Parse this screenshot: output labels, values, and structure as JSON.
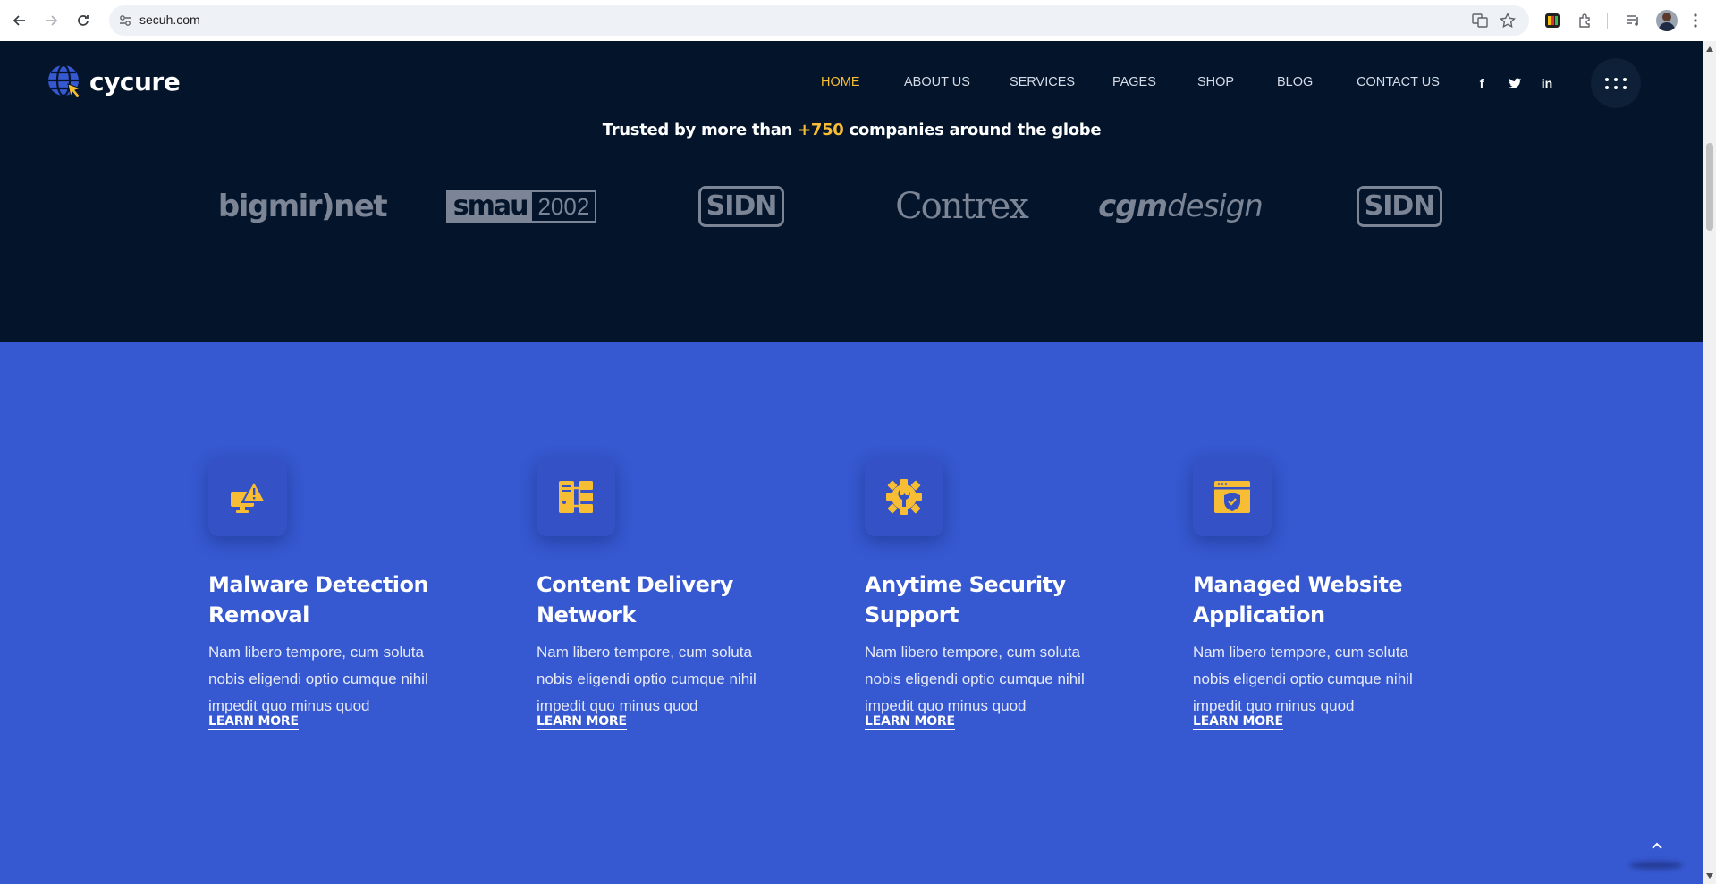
{
  "browser": {
    "url": "secuh.com"
  },
  "header": {
    "logo_text": "cycure",
    "menu": [
      {
        "label": "HOME",
        "active": true
      },
      {
        "label": "ABOUT US",
        "active": false
      },
      {
        "label": "SERVICES",
        "active": false
      },
      {
        "label": "PAGES",
        "active": false
      },
      {
        "label": "SHOP",
        "active": false
      },
      {
        "label": "BLOG",
        "active": false
      },
      {
        "label": "CONTACT US",
        "active": false
      }
    ],
    "social": [
      "facebook-icon",
      "twitter-icon",
      "linkedin-icon"
    ],
    "social_glyphs": {
      "facebook": "f",
      "linkedin": "in"
    }
  },
  "trusted": {
    "prefix": "Trusted by more than",
    "highlight": "+750",
    "suffix": "companies around the globe"
  },
  "partners": {
    "bigmir": "bigmir)net",
    "smau_left": "smau",
    "smau_right": "2002",
    "sidn": "SIDN",
    "contrex": "Contrex",
    "cgm_bold": "cgm",
    "cgm_rest": "design"
  },
  "services": [
    {
      "icon": "malware-warning-icon",
      "title": "Malware Detection Removal",
      "text": "Nam libero tempore, cum soluta nobis eligendi optio cumque nihil impedit quo minus quod",
      "link": "LEARN MORE"
    },
    {
      "icon": "server-network-icon",
      "title": "Content Delivery Network",
      "text": "Nam libero tempore, cum soluta nobis eligendi optio cumque nihil impedit quo minus quod",
      "link": "LEARN MORE"
    },
    {
      "icon": "gear-wrench-icon",
      "title": "Anytime Security Support",
      "text": "Nam libero tempore, cum soluta nobis eligendi optio cumque nihil impedit quo minus quod",
      "link": "LEARN MORE"
    },
    {
      "icon": "browser-shield-icon",
      "title": "Managed Website Application",
      "text": "Nam libero tempore, cum soluta nobis eligendi optio cumque nihil impedit quo minus quod",
      "link": "LEARN MORE"
    }
  ],
  "colors": {
    "dark_bg": "#03142b",
    "blue_bg": "#3658d0",
    "accent": "#f7bd35"
  }
}
